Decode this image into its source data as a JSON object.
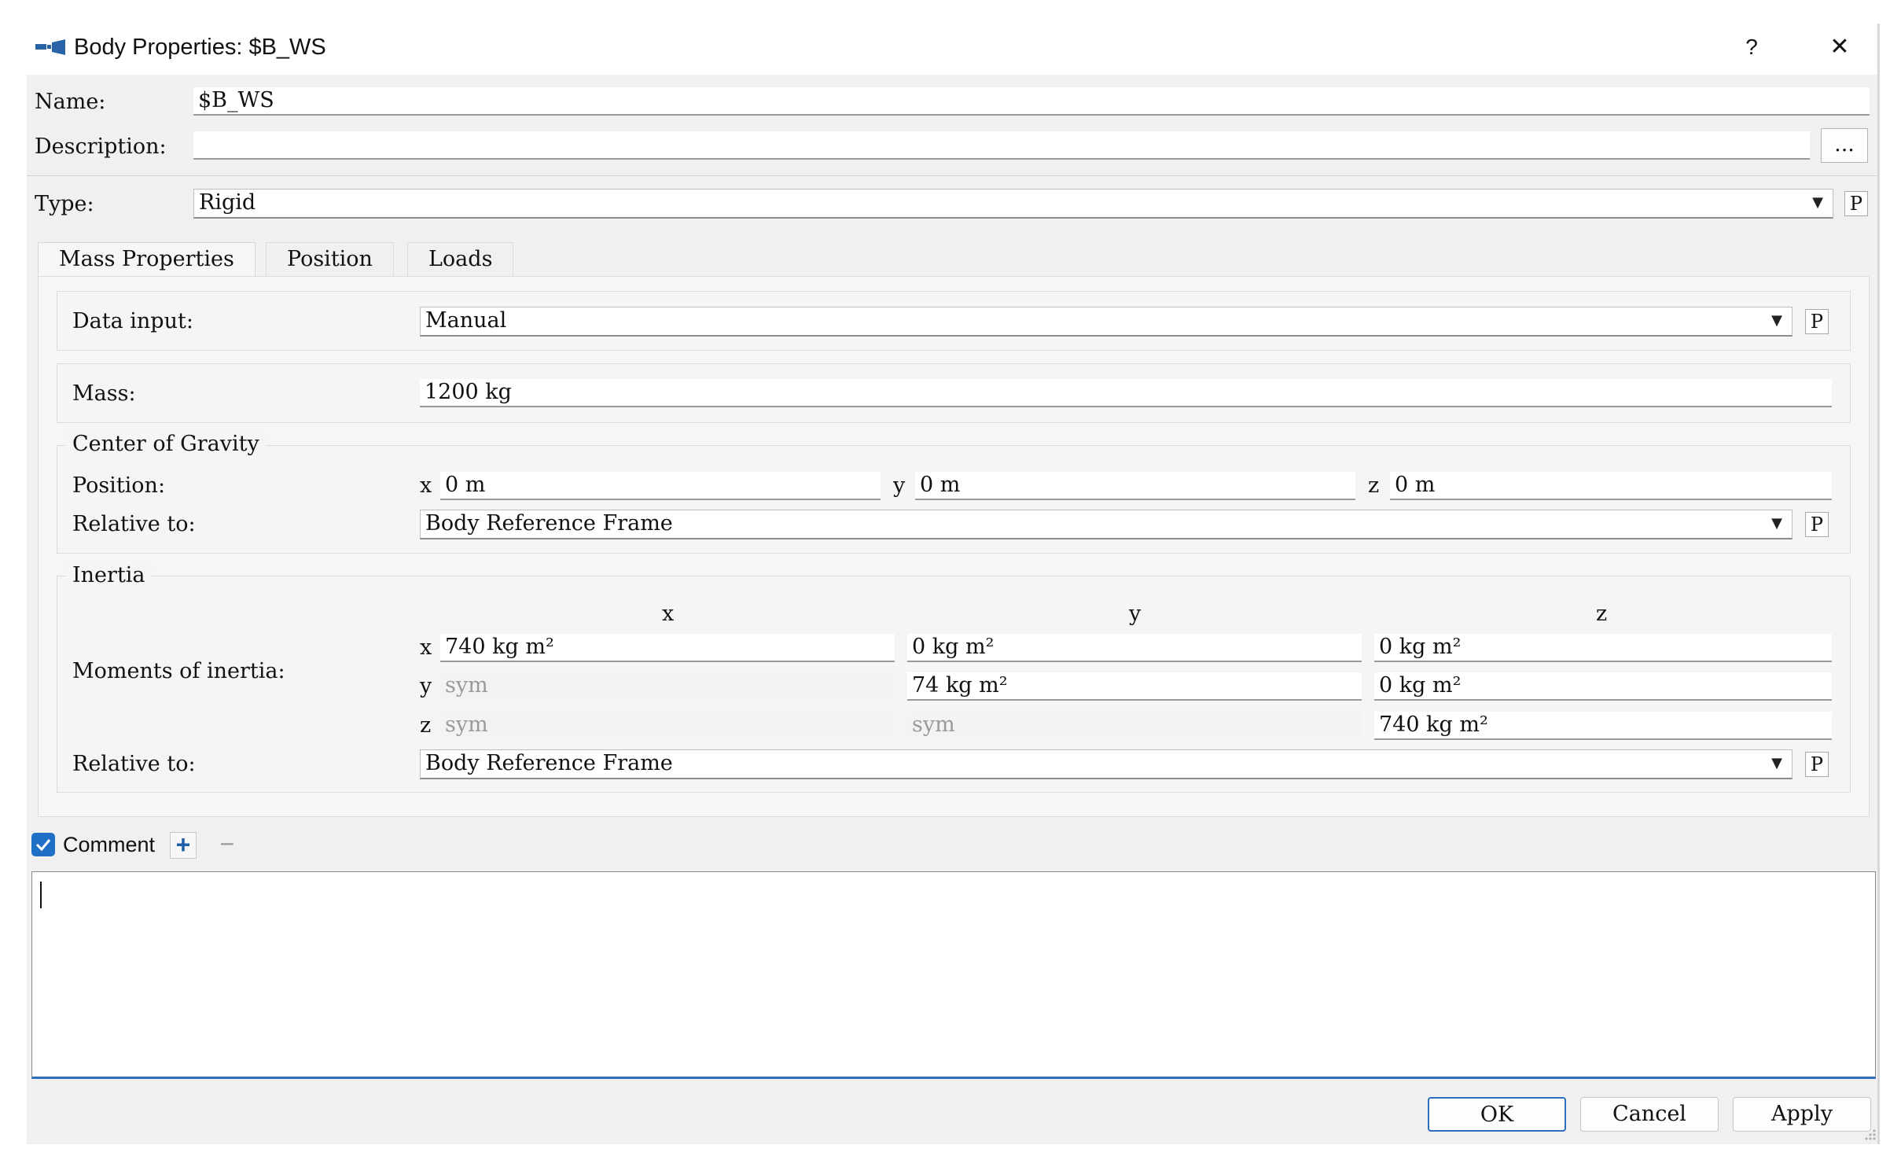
{
  "window": {
    "title": "Body Properties: $B_WS",
    "help_label": "?",
    "close_label": "✕"
  },
  "name": {
    "label": "Name:",
    "value": "$B_WS"
  },
  "description": {
    "label": "Description:",
    "value": "",
    "browse_label": "..."
  },
  "type": {
    "label": "Type:",
    "value": "Rigid",
    "param_label": "P"
  },
  "tabs": [
    {
      "label": "Mass Properties",
      "active": true
    },
    {
      "label": "Position",
      "active": false
    },
    {
      "label": "Loads",
      "active": false
    }
  ],
  "mass_properties": {
    "data_input": {
      "label": "Data input:",
      "value": "Manual",
      "param_label": "P"
    },
    "mass": {
      "label": "Mass:",
      "value": "1200 kg"
    },
    "center_of_gravity": {
      "title": "Center of Gravity",
      "position_label": "Position:",
      "x_axis": "x",
      "x_value": "0 m",
      "y_axis": "y",
      "y_value": "0 m",
      "z_axis": "z",
      "z_value": "0 m",
      "relative_label": "Relative to:",
      "relative_value": "Body Reference Frame",
      "param_label": "P"
    },
    "inertia": {
      "title": "Inertia",
      "columns": [
        "x",
        "y",
        "z"
      ],
      "moments_label": "Moments of inertia:",
      "rows": [
        {
          "axis": "x",
          "cells": [
            "740 kg m²",
            "0 kg m²",
            "0 kg m²"
          ]
        },
        {
          "axis": "y",
          "cells": [
            "sym",
            "74 kg m²",
            "0 kg m²"
          ]
        },
        {
          "axis": "z",
          "cells": [
            "sym",
            "sym",
            "740 kg m²"
          ]
        }
      ],
      "relative_label": "Relative to:",
      "relative_value": "Body Reference Frame",
      "param_label": "P"
    }
  },
  "comment": {
    "checked": true,
    "label": "Comment",
    "add_label": "+",
    "remove_label": "−",
    "text": ""
  },
  "buttons": {
    "ok": "OK",
    "cancel": "Cancel",
    "apply": "Apply"
  },
  "colors": {
    "accent": "#2d6fc0",
    "dialog_bg": "#f0f0f0",
    "checkbox": "#1f6fc7"
  }
}
